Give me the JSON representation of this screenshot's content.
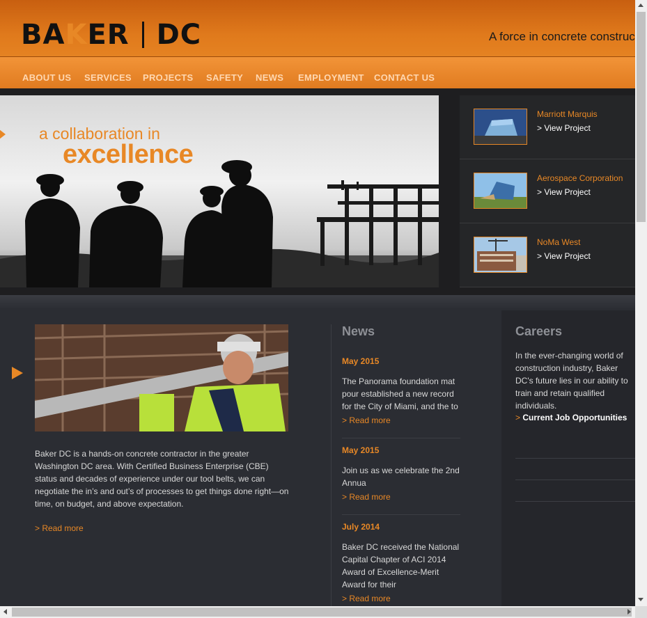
{
  "header": {
    "logo_left": "BA",
    "logo_k": "K",
    "logo_right": "ER",
    "logo_dc": "DC",
    "tagline": "A force in concrete construction"
  },
  "nav": [
    "ABOUT US",
    "SERVICES",
    "PROJECTS",
    "SAFETY",
    "NEWS",
    "EMPLOYMENT",
    "CONTACT US"
  ],
  "hero": {
    "line1": "a collaboration in",
    "line2": "excellence"
  },
  "projects": [
    {
      "title": "Marriott Marquis",
      "link": "> View Project"
    },
    {
      "title": "Aerospace Corporation",
      "link": "> View Project"
    },
    {
      "title": "NoMa West",
      "link": "> View Project"
    }
  ],
  "intro": {
    "text": "Baker DC is a hands-on concrete contractor in the greater Washington DC area. With Certified Business Enterprise (CBE) status and decades of experience under our tool belts, we can negotiate the in’s and out’s of processes to get things done right—on time, on budget, and above expectation.",
    "more": "> Read more"
  },
  "news": {
    "title": "News",
    "items": [
      {
        "date": "May 2015",
        "text": "The Panorama foundation mat pour established a new record for the City of Miami, and the to",
        "more": "> Read more"
      },
      {
        "date": "May 2015",
        "text": "Join us as we celebrate the 2nd Annua",
        "more": "> Read more"
      },
      {
        "date": "July 2014",
        "text": "Baker DC received the National Capital Chapter of ACI 2014 Award of Excellence-Merit Award for their",
        "more": "> Read more"
      }
    ]
  },
  "careers": {
    "title": "Careers",
    "text": "In the ever-changing world of construction industry, Baker DC's future lies in our ability to train and retain qualified individuals.",
    "link_gt": ">",
    "link": "Current Job Opportunities"
  }
}
